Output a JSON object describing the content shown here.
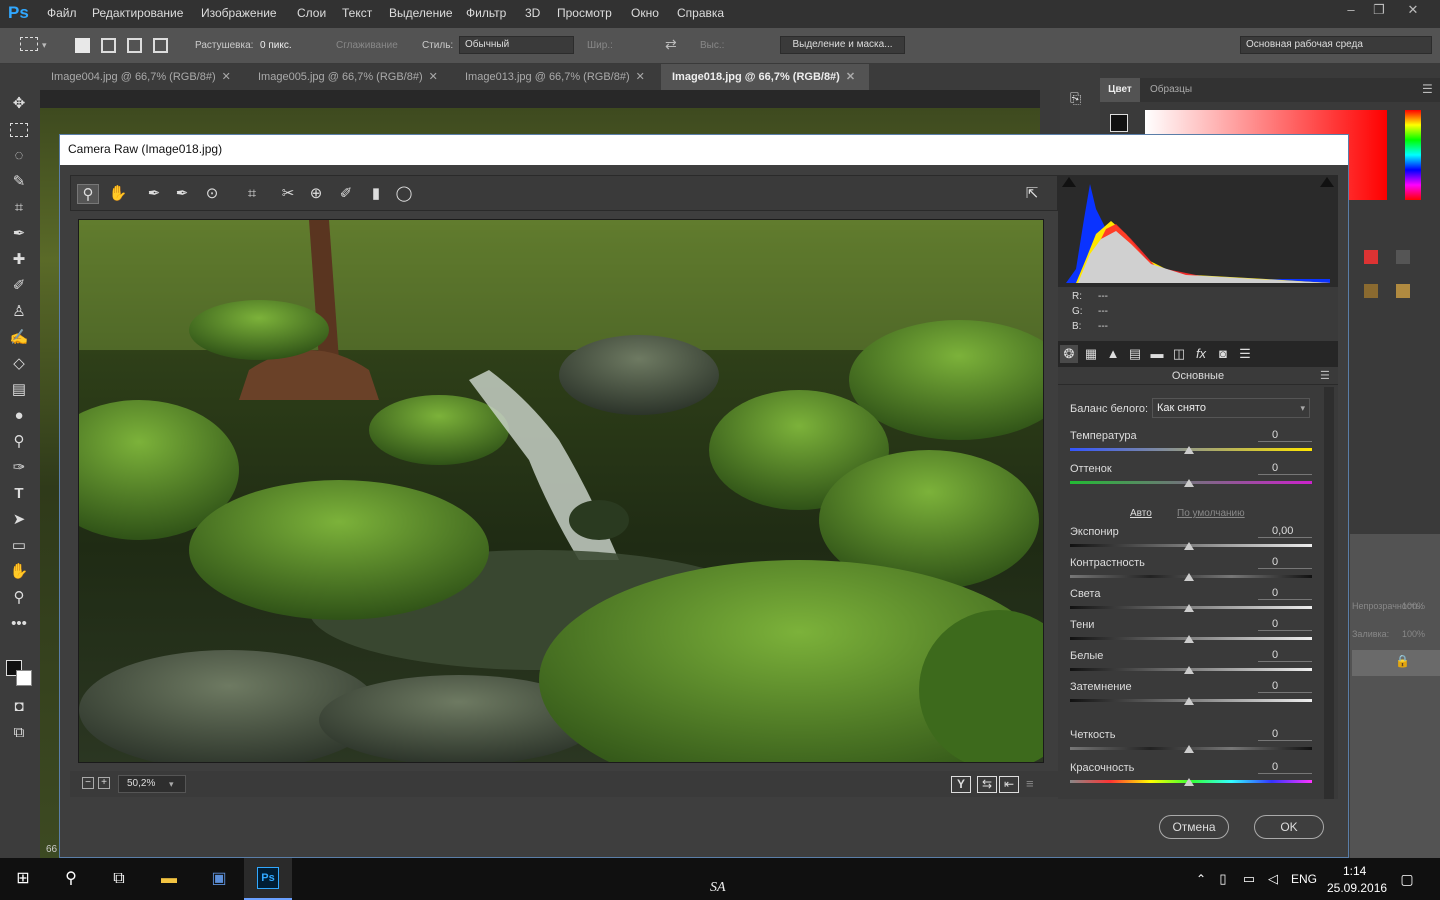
{
  "app": {
    "logo": "Ps",
    "menu": [
      "Файл",
      "Редактирование",
      "Изображение",
      "Слои",
      "Текст",
      "Выделение",
      "Фильтр",
      "3D",
      "Просмотр",
      "Окно",
      "Справка"
    ]
  },
  "options": {
    "feather_label": "Растушевка:",
    "feather_value": "0 пикс.",
    "antialias": "Сглаживание",
    "style_label": "Стиль:",
    "style_value": "Обычный",
    "width_label": "Шир.:",
    "height_label": "Выс.:",
    "select_mask_button": "Выделение и маска...",
    "workspace": "Основная рабочая среда"
  },
  "tabs": [
    {
      "label": "Image004.jpg @ 66,7% (RGB/8#)"
    },
    {
      "label": "Image005.jpg @ 66,7% (RGB/8#)"
    },
    {
      "label": "Image013.jpg @ 66,7% (RGB/8#)"
    },
    {
      "label": "Image018.jpg @ 66,7% (RGB/8#)"
    }
  ],
  "right_panel": {
    "tab_color": "Цвет",
    "tab_swatches": "Образцы",
    "opacity_label": "Непрозрачность:",
    "opacity_value": "100%",
    "fill_label": "Заливка:",
    "fill_value": "100%"
  },
  "canvas_zoom": "66",
  "dialog": {
    "title": "Camera Raw (Image018.jpg)",
    "zoom": "50,2%",
    "rgb": {
      "r_label": "R:",
      "g_label": "G:",
      "b_label": "B:",
      "r": "---",
      "g": "---",
      "b": "---"
    },
    "panel_title": "Основные",
    "wb_label": "Баланс белого:",
    "wb_value": "Как снято",
    "auto_link": "Авто",
    "default_link": "По умолчанию",
    "sliders": [
      {
        "label": "Температура",
        "value": "0"
      },
      {
        "label": "Оттенок",
        "value": "0"
      },
      {
        "label": "Экспонир",
        "value": "0,00"
      },
      {
        "label": "Контрастность",
        "value": "0"
      },
      {
        "label": "Света",
        "value": "0"
      },
      {
        "label": "Тени",
        "value": "0"
      },
      {
        "label": "Белые",
        "value": "0"
      },
      {
        "label": "Затемнение",
        "value": "0"
      },
      {
        "label": "Четкость",
        "value": "0"
      },
      {
        "label": "Красочность",
        "value": "0"
      }
    ],
    "cancel": "Отмена",
    "ok": "OK"
  },
  "taskbar": {
    "lang": "ENG",
    "time": "1:14",
    "date": "25.09.2016",
    "center_text": "SA"
  },
  "icons": {
    "search": "search-icon",
    "close": "close-icon"
  }
}
